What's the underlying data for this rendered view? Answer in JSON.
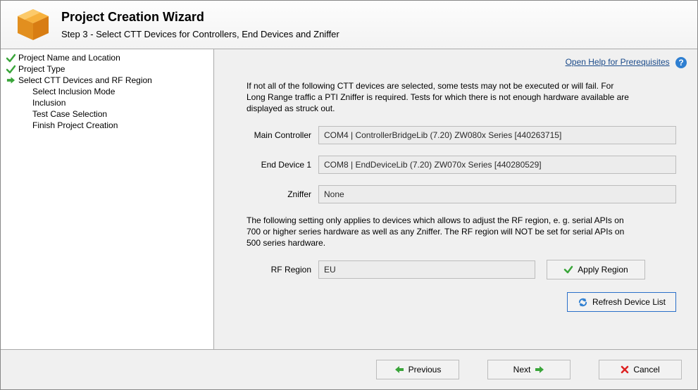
{
  "header": {
    "title": "Project Creation Wizard",
    "subtitle": "Step 3 - Select CTT Devices for Controllers, End Devices and Zniffer"
  },
  "sidebar": {
    "items": [
      {
        "label": "Project Name and Location",
        "status": "done"
      },
      {
        "label": "Project Type",
        "status": "done"
      },
      {
        "label": "Select CTT Devices and RF Region",
        "status": "current"
      },
      {
        "label": "Select Inclusion Mode",
        "status": "pending",
        "indent": true
      },
      {
        "label": "Inclusion",
        "status": "pending",
        "indent": true
      },
      {
        "label": "Test Case Selection",
        "status": "pending",
        "indent": true
      },
      {
        "label": "Finish Project Creation",
        "status": "pending",
        "indent": true
      }
    ]
  },
  "help": {
    "label": "Open Help for Prerequisites"
  },
  "info1": "If not all of the following CTT devices are selected, some tests may not be executed or will fail. For Long Range traffic a PTI Zniffer is required. Tests for which there is not enough hardware available are displayed as struck out.",
  "fields": {
    "mainControllerLabel": "Main Controller",
    "mainControllerValue": "COM4 | ControllerBridgeLib (7.20) ZW080x Series [440263715]",
    "endDeviceLabel": "End Device 1",
    "endDeviceValue": "COM8 | EndDeviceLib (7.20) ZW070x Series [440280529]",
    "znifferLabel": "Zniffer",
    "znifferValue": "None",
    "rfRegionLabel": "RF Region",
    "rfRegionValue": "EU"
  },
  "info2": "The following setting only applies to devices which allows to adjust the RF region, e. g. serial APIs on 700 or higher series hardware as well as any Zniffer. The RF region will NOT be set for serial APIs on 500 series hardware.",
  "buttons": {
    "applyRegion": "Apply Region",
    "refresh": "Refresh Device List",
    "previous": "Previous",
    "next": "Next",
    "cancel": "Cancel"
  }
}
